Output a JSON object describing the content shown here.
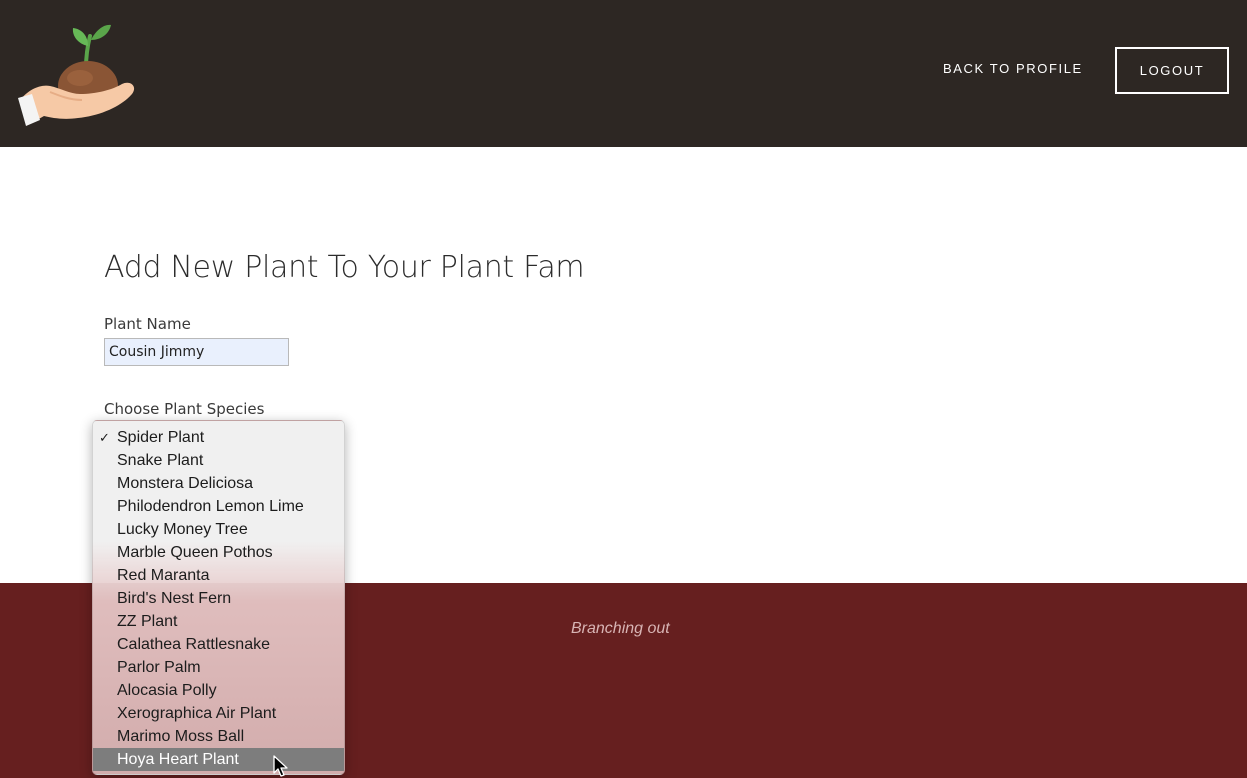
{
  "header": {
    "back_link": "BACK TO PROFILE",
    "logout_label": "LOGOUT"
  },
  "main": {
    "title": "Add New Plant To Your Plant Fam",
    "plant_name_label": "Plant Name",
    "plant_name_value": "Cousin Jimmy",
    "species_label": "Choose Plant Species"
  },
  "species_dropdown": {
    "selected": "Spider Plant",
    "highlighted": "Hoya Heart Plant",
    "options": [
      "Spider Plant",
      "Snake Plant",
      "Monstera Deliciosa",
      "Philodendron Lemon Lime",
      "Lucky Money Tree",
      "Marble Queen Pothos",
      "Red Maranta",
      "Bird's Nest Fern",
      "ZZ Plant",
      "Calathea Rattlesnake",
      "Parlor Palm",
      "Alocasia Polly",
      "Xerographica Air Plant",
      "Marimo Moss Ball",
      "Hoya Heart Plant"
    ]
  },
  "footer": {
    "tagline": "Branching out"
  },
  "colors": {
    "header_bg": "#2d2723",
    "footer_bg": "#661f1f",
    "input_bg": "#e9f0fd",
    "highlight_bg": "#7d7d7d"
  },
  "icons": {
    "logo": "hand-holding-seedling-icon",
    "check": "checkmark-icon",
    "cursor": "mouse-pointer-icon"
  }
}
